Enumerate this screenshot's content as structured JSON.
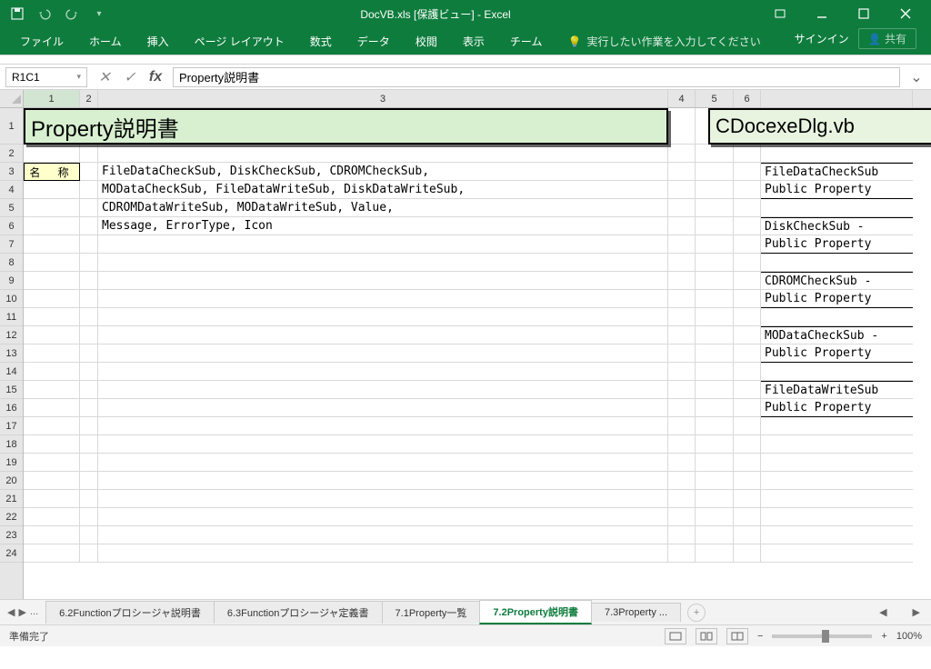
{
  "app": {
    "title": "DocVB.xls  [保護ビュー] - Excel",
    "signin": "サインイン",
    "share": "共有"
  },
  "ribbon": {
    "tabs": [
      "ファイル",
      "ホーム",
      "挿入",
      "ページ レイアウト",
      "数式",
      "データ",
      "校閲",
      "表示",
      "チーム"
    ],
    "tellme": "実行したい作業を入力してください"
  },
  "namebox": "R1C1",
  "formula": "Property説明書",
  "columns": [
    "1",
    "2",
    "3",
    "4",
    "5",
    "6"
  ],
  "rows": [
    "1",
    "2",
    "3",
    "4",
    "5",
    "6",
    "7",
    "8",
    "9",
    "10",
    "11",
    "12",
    "13",
    "14",
    "15",
    "16",
    "17",
    "18",
    "19",
    "20",
    "21",
    "22",
    "23",
    "24"
  ],
  "cells": {
    "title_left": "Property説明書",
    "title_right": "CDocexeDlg.vb",
    "label_meisho": "名 称",
    "row3": "FileDataCheckSub, DiskCheckSub, CDROMCheckSub,",
    "row4": "MODataCheckSub, FileDataWriteSub, DiskDataWriteSub,",
    "row5": "CDROMDataWriteSub, MODataWriteSub, Value,",
    "row6": "Message, ErrorType, Icon",
    "r3c7": "FileDataCheckSub",
    "r4c7": "Public Property",
    "r6c7": "DiskCheckSub - ",
    "r7c7": "Public Property",
    "r9c7": "CDROMCheckSub -",
    "r10c7": "Public Property",
    "r12c7": "MODataCheckSub -",
    "r13c7": "Public Property",
    "r15c7": "FileDataWriteSub",
    "r16c7": "Public Property"
  },
  "sheettabs": {
    "items": [
      "6.2Functionプロシージャ説明書",
      "6.3Functionプロシージャ定義書",
      "7.1Property一覧",
      "7.2Property説明書",
      "7.3Property ..."
    ],
    "active_index": 3,
    "ellipsis": "..."
  },
  "status": {
    "ready": "準備完了",
    "zoom": "100%"
  },
  "icons": {
    "save": "save",
    "undo": "undo",
    "redo": "redo",
    "min": "min",
    "max": "max",
    "restore": "restore",
    "close": "close",
    "bulb": "bulb"
  }
}
